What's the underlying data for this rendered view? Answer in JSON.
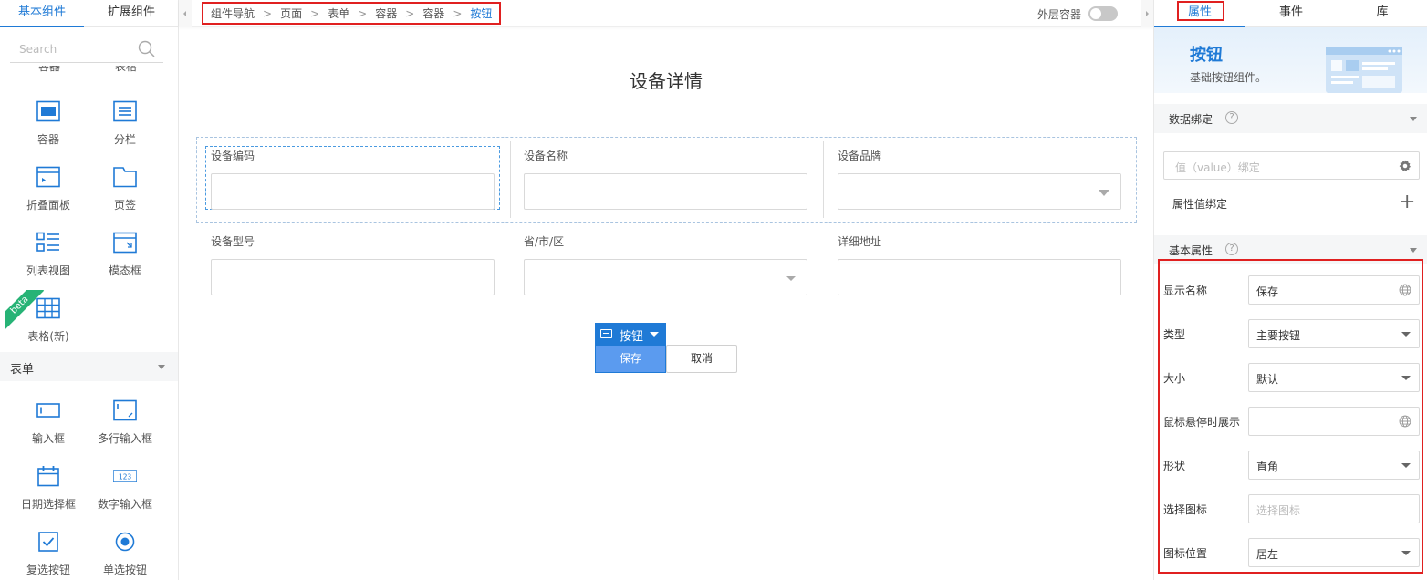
{
  "left_panel": {
    "tabs": [
      "基本组件",
      "扩展组件"
    ],
    "search_placeholder": "Search",
    "cut_labels": [
      "容器",
      "表格"
    ],
    "components": [
      {
        "label": "容器",
        "icon": "container-icon"
      },
      {
        "label": "分栏",
        "icon": "columns-icon"
      },
      {
        "label": "折叠面板",
        "icon": "collapse-panel-icon"
      },
      {
        "label": "页签",
        "icon": "folder-tab-icon"
      },
      {
        "label": "列表视图",
        "icon": "list-view-icon"
      },
      {
        "label": "模态框",
        "icon": "modal-icon"
      },
      {
        "label": "表格(新)",
        "icon": "table-icon"
      }
    ],
    "beta_badge": "beta",
    "section": "表单",
    "form_components": [
      {
        "label": "输入框",
        "icon": "input-icon"
      },
      {
        "label": "多行输入框",
        "icon": "textarea-icon"
      },
      {
        "label": "日期选择框",
        "icon": "calendar-icon"
      },
      {
        "label": "数字输入框",
        "icon": "number-input-icon"
      },
      {
        "label": "复选按钮",
        "icon": "checkbox-icon"
      },
      {
        "label": "单选按钮",
        "icon": "radio-icon"
      }
    ]
  },
  "canvas": {
    "breadcrumb": [
      "组件导航",
      "页面",
      "表单",
      "容器",
      "容器",
      "按钮"
    ],
    "outer_container_label": "外层容器",
    "form_title": "设备详情",
    "fields": [
      {
        "label": "设备编码",
        "type": "text"
      },
      {
        "label": "设备名称",
        "type": "text"
      },
      {
        "label": "设备品牌",
        "type": "select"
      },
      {
        "label": "设备型号",
        "type": "text"
      },
      {
        "label": "省/市/区",
        "type": "select"
      },
      {
        "label": "详细地址",
        "type": "text"
      }
    ],
    "selected_component_label": "按钮",
    "save_button": "保存",
    "cancel_button": "取消"
  },
  "right_panel": {
    "tabs": [
      "属性",
      "事件",
      "库"
    ],
    "hero_title": "按钮",
    "hero_desc": "基础按钮组件。",
    "data_binding_section": "数据绑定",
    "help_glyph": "?",
    "value_binding_placeholder": "值（value）绑定",
    "attribute_binding_label": "属性值绑定",
    "add_glyph": "+",
    "basic_props_section": "基本属性",
    "props": [
      {
        "label": "显示名称",
        "value": "保存",
        "kind": "i18n"
      },
      {
        "label": "类型",
        "value": "主要按钮",
        "kind": "select"
      },
      {
        "label": "大小",
        "value": "默认",
        "kind": "select"
      },
      {
        "label": "鼠标悬停时展示",
        "value": "",
        "kind": "i18n"
      },
      {
        "label": "形状",
        "value": "直角",
        "kind": "select"
      },
      {
        "label": "选择图标",
        "value": "选择图标",
        "kind": "placeholder"
      },
      {
        "label": "图标位置",
        "value": "居左",
        "kind": "select"
      }
    ]
  },
  "colors": {
    "accent": "#1f7ad6",
    "highlight_border": "#e02020",
    "beta": "#27b376"
  }
}
